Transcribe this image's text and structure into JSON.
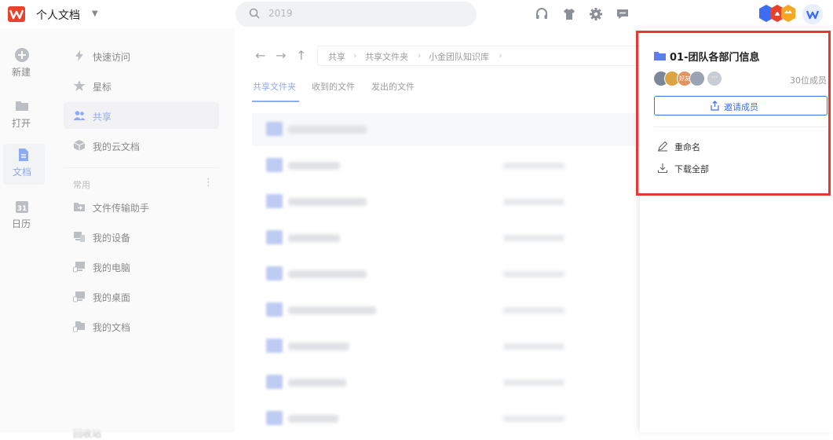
{
  "app": {
    "title": "个人文档"
  },
  "search": {
    "placeholder": "2019"
  },
  "rail": [
    {
      "label": "新建"
    },
    {
      "label": "打开"
    },
    {
      "label": "文档"
    },
    {
      "label": "日历"
    }
  ],
  "rail_calendar_day": "31",
  "nav": {
    "items": [
      {
        "label": "快速访问"
      },
      {
        "label": "星标"
      },
      {
        "label": "共享"
      },
      {
        "label": "我的云文档"
      }
    ],
    "section_label": "常用",
    "section_more": "⋮",
    "common": [
      {
        "label": "文件传输助手"
      },
      {
        "label": "我的设备"
      },
      {
        "label": "我的电脑"
      },
      {
        "label": "我的桌面"
      },
      {
        "label": "我的文档"
      }
    ],
    "bottom_label": "回收站"
  },
  "breadcrumb": [
    {
      "label": "共享"
    },
    {
      "label": "共享文件夹"
    },
    {
      "label": "小金团队知识库"
    }
  ],
  "tabs": [
    {
      "label": "共享文件夹"
    },
    {
      "label": "收到的文件"
    },
    {
      "label": "发出的文件"
    }
  ],
  "panel": {
    "folder_title": "01-团队各部门信息",
    "member_count": "30位成员",
    "member_avatar_text": "好友",
    "member_more": "···",
    "invite_label": "邀请成员",
    "menu": [
      {
        "label": "重命名"
      },
      {
        "label": "下载全部"
      }
    ]
  },
  "colors": {
    "accent": "#3d6df2",
    "highlight_border": "#e53935",
    "brand_red": "#e8412c"
  }
}
